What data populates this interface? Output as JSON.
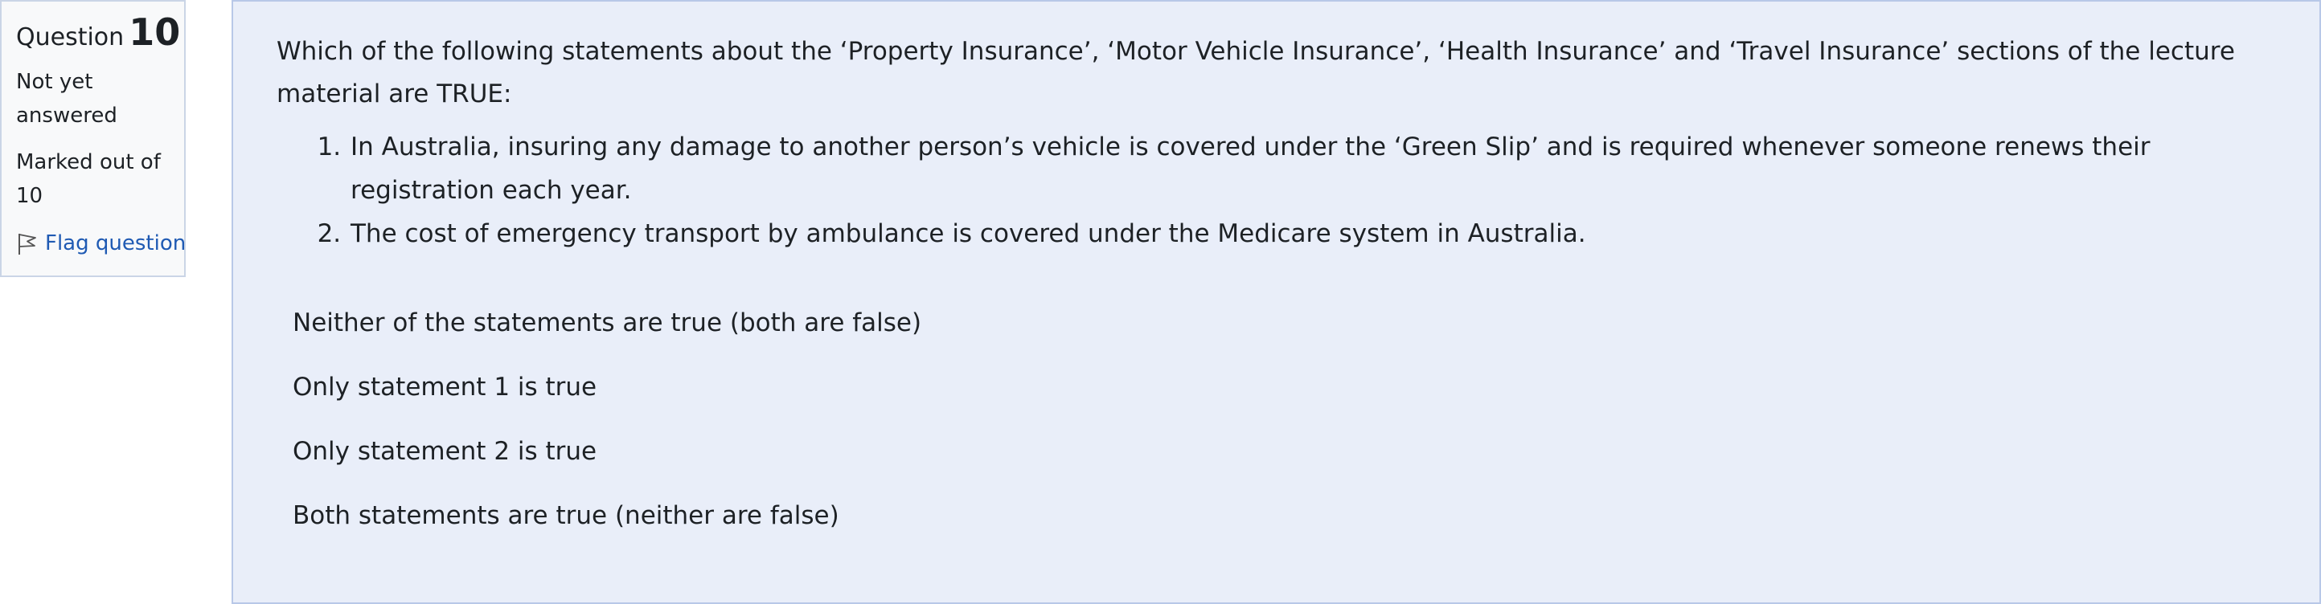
{
  "question": {
    "label": "Question",
    "number": "10",
    "state": "Not yet answered",
    "grade": "Marked out of 10",
    "flag_label": "Flag question",
    "flag_icon": "flag-icon"
  },
  "content": {
    "intro": "Which of the following statements about the ‘Property Insurance’, ‘Motor Vehicle Insurance’, ‘Health Insurance’ and ‘Travel Insurance’ sections of the lecture material are TRUE:",
    "statements": [
      "In Australia, insuring any damage to another person’s vehicle is covered under the ‘Green Slip’ and is required whenever someone renews their registration each year.",
      "The cost of emergency transport by ambulance is covered under the Medicare system in Australia."
    ],
    "answers": [
      "Neither of the statements are true (both are false)",
      "Only statement 1 is true",
      "Only statement 2 is true",
      "Both statements are true (neither are false)"
    ]
  },
  "colors": {
    "content_background": "#e9eef9",
    "info_background": "#f8f9fa",
    "link": "#1f5ab3"
  }
}
